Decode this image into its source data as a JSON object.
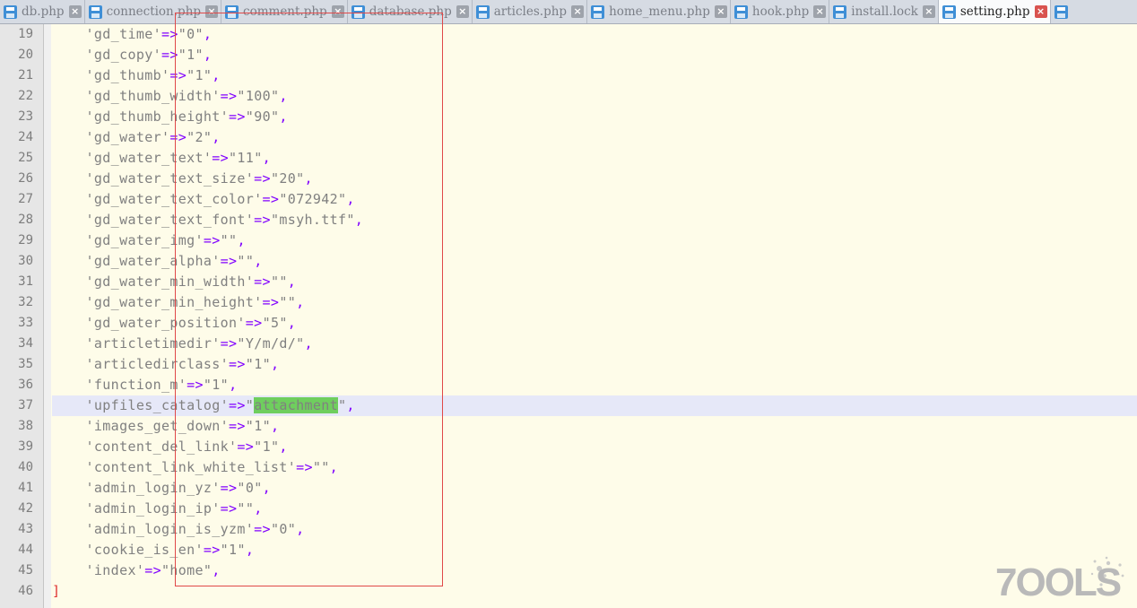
{
  "tabs": [
    {
      "label": "db.php",
      "active": false
    },
    {
      "label": "connection.php",
      "active": false
    },
    {
      "label": "comment.php",
      "active": false
    },
    {
      "label": "database.php",
      "active": false
    },
    {
      "label": "articles.php",
      "active": false
    },
    {
      "label": "home_menu.php",
      "active": false
    },
    {
      "label": "hook.php",
      "active": false
    },
    {
      "label": "install.lock",
      "active": false
    },
    {
      "label": "setting.php",
      "active": true
    }
  ],
  "editor": {
    "current_line": 37,
    "lines": [
      {
        "number": "19",
        "key": "gd_time",
        "value": "0"
      },
      {
        "number": "20",
        "key": "gd_copy",
        "value": "1"
      },
      {
        "number": "21",
        "key": "gd_thumb",
        "value": "1"
      },
      {
        "number": "22",
        "key": "gd_thumb_width",
        "value": "100"
      },
      {
        "number": "23",
        "key": "gd_thumb_height",
        "value": "90"
      },
      {
        "number": "24",
        "key": "gd_water",
        "value": "2"
      },
      {
        "number": "25",
        "key": "gd_water_text",
        "value": "11"
      },
      {
        "number": "26",
        "key": "gd_water_text_size",
        "value": "20"
      },
      {
        "number": "27",
        "key": "gd_water_text_color",
        "value": "072942"
      },
      {
        "number": "28",
        "key": "gd_water_text_font",
        "value": "msyh.ttf"
      },
      {
        "number": "29",
        "key": "gd_water_img",
        "value": ""
      },
      {
        "number": "30",
        "key": "gd_water_alpha",
        "value": ""
      },
      {
        "number": "31",
        "key": "gd_water_min_width",
        "value": ""
      },
      {
        "number": "32",
        "key": "gd_water_min_height",
        "value": ""
      },
      {
        "number": "33",
        "key": "gd_water_position",
        "value": "5"
      },
      {
        "number": "34",
        "key": "articletimedir",
        "value": "Y/m/d/"
      },
      {
        "number": "35",
        "key": "articledirclass",
        "value": "1"
      },
      {
        "number": "36",
        "key": "function_m",
        "value": "1"
      },
      {
        "number": "37",
        "key": "upfiles_catalog",
        "value": "attachment",
        "selected": true
      },
      {
        "number": "38",
        "key": "images_get_down",
        "value": "1"
      },
      {
        "number": "39",
        "key": "content_del_link",
        "value": "1"
      },
      {
        "number": "40",
        "key": "content_link_white_list",
        "value": ""
      },
      {
        "number": "41",
        "key": "admin_login_yz",
        "value": "0"
      },
      {
        "number": "42",
        "key": "admin_login_ip",
        "value": ""
      },
      {
        "number": "43",
        "key": "admin_login_is_yzm",
        "value": "0"
      },
      {
        "number": "44",
        "key": "cookie_is_en",
        "value": "1"
      },
      {
        "number": "45",
        "key": "index",
        "value": "home"
      },
      {
        "number": "46",
        "closing": "]"
      }
    ]
  },
  "watermark": {
    "text": "7OOLS"
  },
  "colors": {
    "editor_bg": "#fefce9",
    "string": "#808080",
    "operator": "#8000ff",
    "selection": "#6fce5e",
    "current_line": "#e6e8f8",
    "bracket": "#e03030",
    "annotation_box": "#e04848"
  }
}
